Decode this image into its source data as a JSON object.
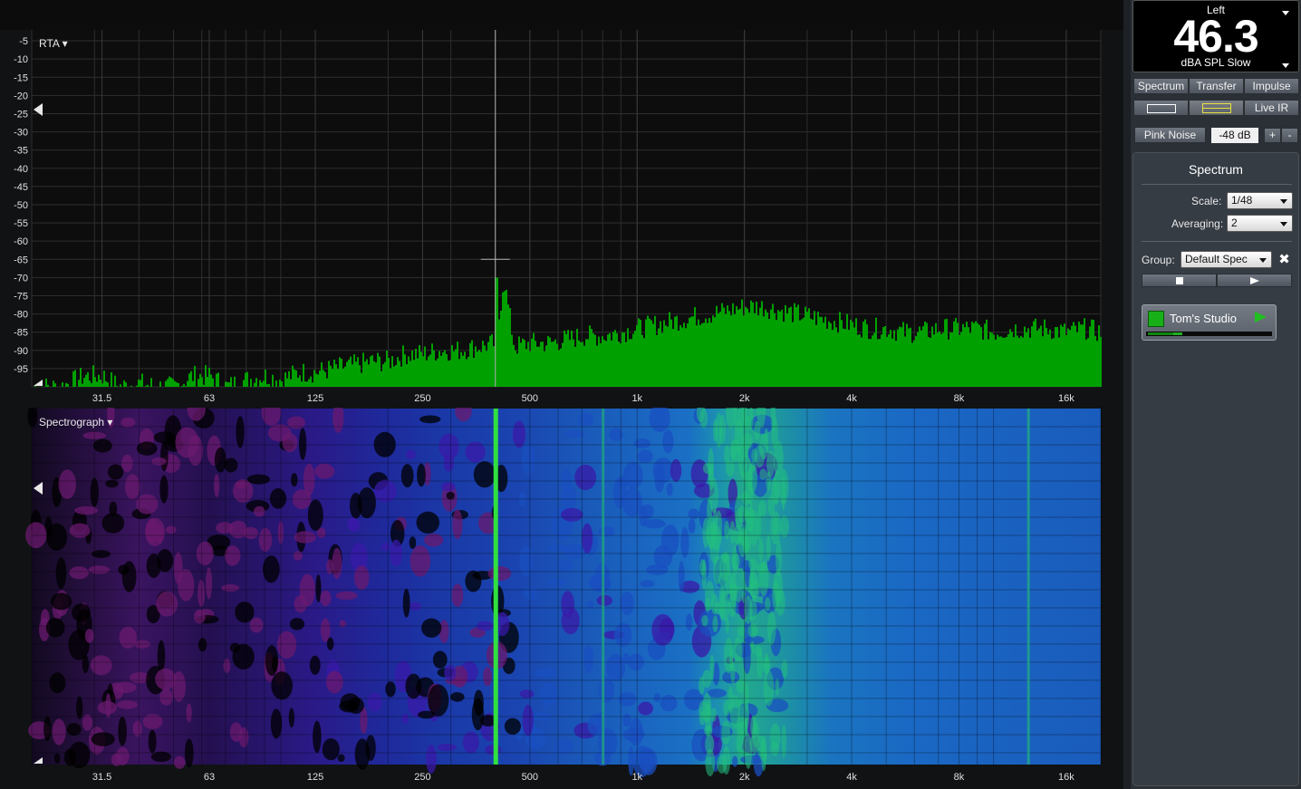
{
  "meter": {
    "channel": "Left",
    "value": "46.3",
    "units": "dBA SPL Slow"
  },
  "mode_tabs": [
    "Spectrum",
    "Transfer",
    "Impulse"
  ],
  "live_ir_label": "Live IR",
  "generator": {
    "signal": "Pink Noise",
    "level": "-48 dB",
    "plus": "+",
    "minus": "-"
  },
  "panel": {
    "title": "Spectrum",
    "scale_label": "Scale:",
    "scale_value": "1/48",
    "averaging_label": "Averaging:",
    "averaging_value": "2",
    "group_label": "Group:",
    "group_value": "Default Spec"
  },
  "measurement": {
    "name": "Tom's Studio"
  },
  "rta": {
    "menu_label": "RTA ▾"
  },
  "spectrograph": {
    "menu_label": "Spectrograph ▾"
  },
  "colors": {
    "spectrum_fill": "#00a000",
    "cursor": "#b0b0b0",
    "panel_bg": "#2b3037"
  },
  "chart_data": [
    {
      "type": "area",
      "title": "RTA",
      "x_scale": "log",
      "xlim": [
        20,
        20000
      ],
      "ylim": [
        -100,
        -2
      ],
      "grid": true,
      "x_ticks": [
        {
          "label": "31.5",
          "value": 31.5
        },
        {
          "label": "63",
          "value": 63
        },
        {
          "label": "125",
          "value": 125
        },
        {
          "label": "250",
          "value": 250
        },
        {
          "label": "500",
          "value": 500
        },
        {
          "label": "1k",
          "value": 1000
        },
        {
          "label": "2k",
          "value": 2000
        },
        {
          "label": "4k",
          "value": 4000
        },
        {
          "label": "8k",
          "value": 8000
        },
        {
          "label": "16k",
          "value": 16000
        }
      ],
      "y_ticks": [
        -5,
        -10,
        -15,
        -20,
        -25,
        -30,
        -35,
        -40,
        -45,
        -50,
        -55,
        -60,
        -65,
        -70,
        -75,
        -80,
        -85,
        -90,
        -95
      ],
      "series": [
        {
          "x": [
            24,
            28,
            31.5,
            35,
            40,
            45,
            50,
            56,
            63,
            70,
            80,
            90,
            100,
            112,
            125,
            140,
            160,
            180,
            200,
            224,
            250,
            280,
            315,
            355,
            400,
            420,
            450,
            500,
            560,
            630,
            710,
            800,
            900,
            1000,
            1120,
            1250,
            1400,
            1600,
            1800,
            2000,
            2240,
            2500,
            2800,
            3150,
            3550,
            4000,
            4500,
            5000,
            5600,
            6300,
            7100,
            8000,
            9000,
            10000,
            11200,
            12500,
            14000,
            16000,
            18000,
            20000
          ],
          "y": [
            -100,
            -97,
            -97,
            -100,
            -99,
            -100,
            -100,
            -97,
            -97,
            -100,
            -98,
            -97,
            -98,
            -96,
            -96,
            -95,
            -94,
            -93,
            -93,
            -91,
            -91,
            -90,
            -90,
            -89,
            -88,
            -70,
            -89,
            -88,
            -88,
            -87,
            -86,
            -86,
            -85,
            -84,
            -83,
            -82,
            -81,
            -80,
            -79,
            -78,
            -78,
            -79,
            -80,
            -81,
            -82,
            -83,
            -84,
            -84,
            -85,
            -85,
            -84,
            -84,
            -84,
            -85,
            -84,
            -84,
            -84,
            -85,
            -84,
            -85
          ]
        }
      ],
      "cursor": {
        "x": 400,
        "y": -65
      }
    },
    {
      "type": "heatmap",
      "title": "Spectrograph",
      "x_scale": "log",
      "xlim": [
        20,
        20000
      ],
      "x_ticks": [
        {
          "label": "31.5",
          "value": 31.5
        },
        {
          "label": "63",
          "value": 63
        },
        {
          "label": "125",
          "value": 125
        },
        {
          "label": "250",
          "value": 250
        },
        {
          "label": "500",
          "value": 500
        },
        {
          "label": "1k",
          "value": 1000
        },
        {
          "label": "2k",
          "value": 2000
        },
        {
          "label": "4k",
          "value": 4000
        },
        {
          "label": "8k",
          "value": 8000
        },
        {
          "label": "16k",
          "value": 16000
        }
      ],
      "colormap": [
        "#000000",
        "#6a1a6e",
        "#3a1aa8",
        "#1a4fc0",
        "#1a7fd0",
        "#22c080",
        "#30e040"
      ],
      "lines": [
        {
          "x": 400,
          "color": "#30e040"
        },
        {
          "x": 800,
          "color": "#22b080"
        },
        {
          "x": 12500,
          "color": "#22b080"
        }
      ]
    }
  ]
}
